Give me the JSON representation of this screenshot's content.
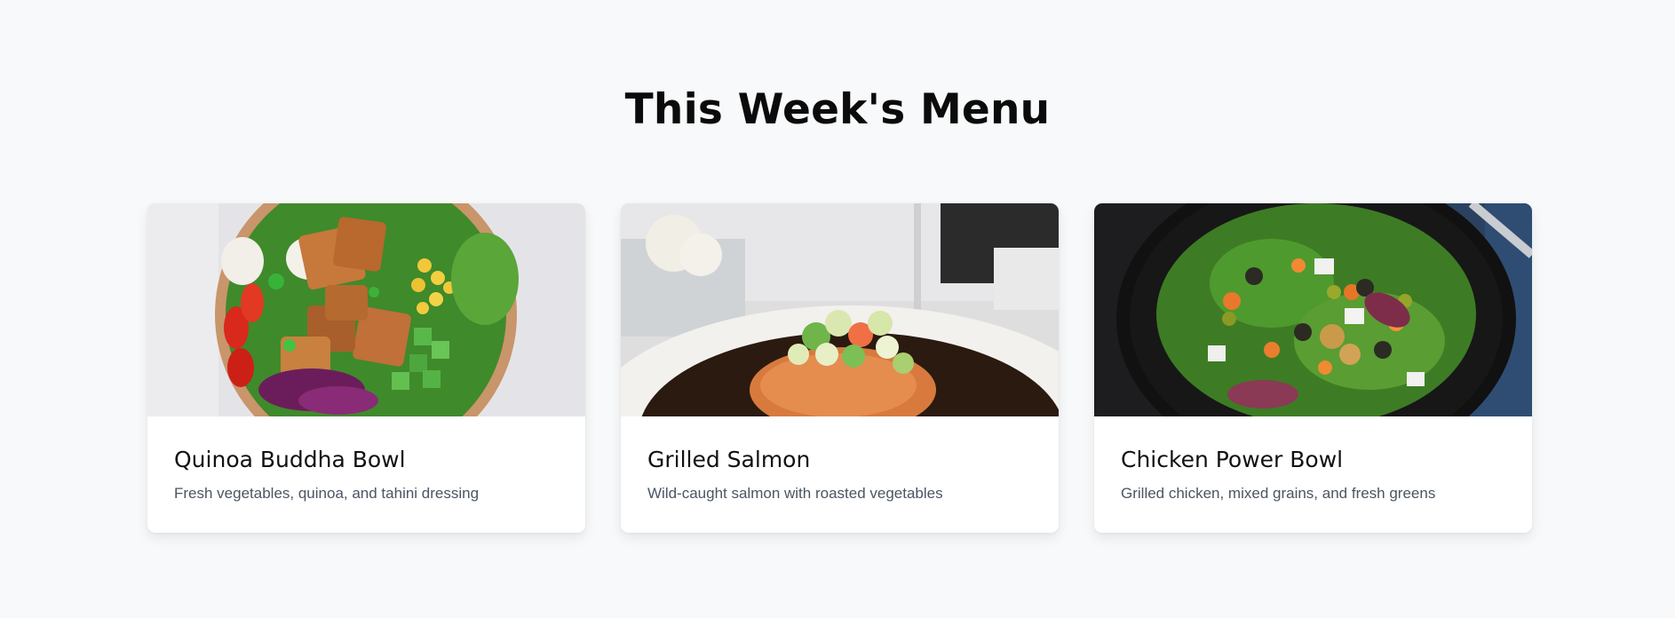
{
  "menu": {
    "title": "This Week's Menu",
    "items": [
      {
        "name": "Quinoa Buddha Bowl",
        "description": "Fresh vegetables, quinoa, and tahini dressing"
      },
      {
        "name": "Grilled Salmon",
        "description": "Wild-caught salmon with roasted vegetables"
      },
      {
        "name": "Chicken Power Bowl",
        "description": "Grilled chicken, mixed grains, and fresh greens"
      }
    ]
  },
  "colors": {
    "background": "#f8f9fa",
    "card": "#ffffff",
    "title_text": "#0b0b0b",
    "description_text": "#4b5563"
  }
}
